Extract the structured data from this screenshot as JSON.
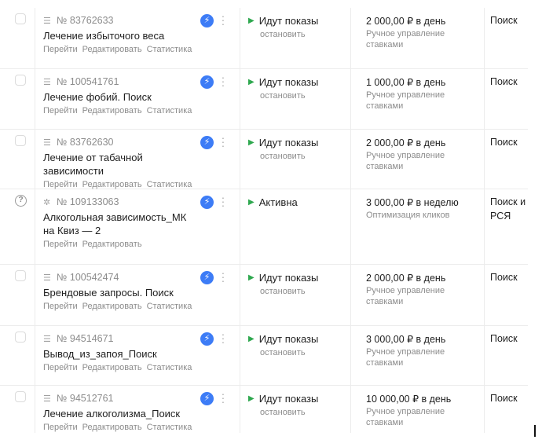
{
  "campaigns": [
    {
      "type_icon": "text-ad-icon",
      "has_help": false,
      "id": "№ 83762633",
      "name": "Лечение избыточого веса",
      "links": [
        "Перейти",
        "Редактировать",
        "Статистика"
      ],
      "status": "Идут показы",
      "status_action": "остановить",
      "budget": "2 000,00 ₽ в день",
      "strategy": "Ручное управление ставками",
      "placement": "Поиск"
    },
    {
      "type_icon": "text-ad-icon",
      "has_help": false,
      "id": "№ 100541761",
      "name": "Лечение фобий. Поиск",
      "links": [
        "Перейти",
        "Редактировать",
        "Статистика"
      ],
      "status": "Идут показы",
      "status_action": "остановить",
      "budget": "1 000,00 ₽ в день",
      "strategy": "Ручное управление ставками",
      "placement": "Поиск"
    },
    {
      "type_icon": "text-ad-icon",
      "has_help": false,
      "id": "№ 83762630",
      "name": "Лечение от табачной зависимости",
      "links": [
        "Перейти",
        "Редактировать",
        "Статистика"
      ],
      "status": "Идут показы",
      "status_action": "остановить",
      "budget": "2 000,00 ₽ в день",
      "strategy": "Ручное управление ставками",
      "placement": "Поиск"
    },
    {
      "type_icon": "master-campaign-icon",
      "has_help": true,
      "id": "№ 109133063",
      "name": "Алкогольная зависимость_МК на Квиз — 2",
      "links": [
        "Перейти",
        "Редактировать"
      ],
      "status": "Активна",
      "status_action": "",
      "budget": "3 000,00 ₽ в неделю",
      "strategy": "Оптимизация кликов",
      "placement": "Поиск и РСЯ"
    },
    {
      "type_icon": "text-ad-icon",
      "has_help": false,
      "id": "№ 100542474",
      "name": "Брендовые запросы. Поиск",
      "links": [
        "Перейти",
        "Редактировать",
        "Статистика"
      ],
      "status": "Идут показы",
      "status_action": "остановить",
      "budget": "2 000,00 ₽ в день",
      "strategy": "Ручное управление ставками",
      "placement": "Поиск"
    },
    {
      "type_icon": "text-ad-icon",
      "has_help": false,
      "id": "№ 94514671",
      "name": "Вывод_из_запоя_Поиск",
      "links": [
        "Перейти",
        "Редактировать",
        "Статистика"
      ],
      "status": "Идут показы",
      "status_action": "остановить",
      "budget": "3 000,00 ₽ в день",
      "strategy": "Ручное управление ставками",
      "placement": "Поиск"
    },
    {
      "type_icon": "text-ad-icon",
      "has_help": false,
      "id": "№ 94512761",
      "name": "Лечение алкоголизма_Поиск",
      "links": [
        "Перейти",
        "Редактировать",
        "Статистика"
      ],
      "status": "Идут показы",
      "status_action": "остановить",
      "budget": "10 000,00 ₽ в день",
      "strategy": "Ручное управление ставками",
      "placement": "Поиск"
    }
  ],
  "colors": {
    "accent_blue": "#3d7cf6",
    "status_green": "#2fa84f",
    "muted_text": "#8c8c8c",
    "divider": "#ececec"
  },
  "icons": {
    "bolt": "lightning-bolt-icon",
    "menu": "vertical-dots-icon",
    "play": "play-icon",
    "help": "question-circle-icon"
  }
}
